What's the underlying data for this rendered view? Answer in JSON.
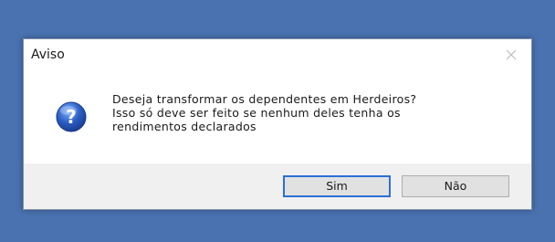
{
  "window": {
    "title": "Aviso"
  },
  "message": {
    "line1": "Deseja transformar os dependentes em Herdeiros?",
    "line2": "Isso só deve ser feito se nenhum deles tenha os",
    "line3": "rendimentos declarados"
  },
  "icon": {
    "name": "question-icon",
    "glyph": "?",
    "color": "#2a5cc2"
  },
  "buttons": {
    "yes_label": "Sim",
    "no_label": "Não",
    "default": "yes"
  },
  "colors": {
    "desktop": "#4a72b0",
    "footer": "#f0f0f0",
    "default_button_border": "#2b6fd6"
  }
}
